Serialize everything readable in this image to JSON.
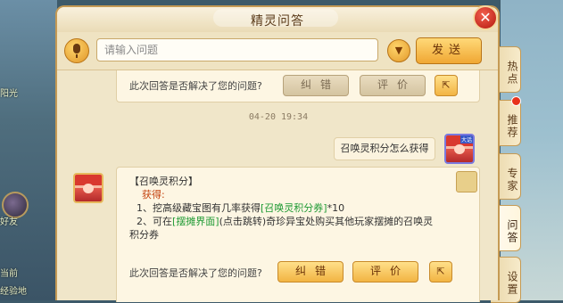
{
  "window": {
    "title": "精灵问答"
  },
  "input": {
    "placeholder": "请输入问题",
    "send_label": "发送"
  },
  "chat": {
    "prev_feedback": {
      "question": "此次回答是否解决了您的问题?",
      "correct_label": "纠错",
      "rate_label": "评价"
    },
    "timestamp": "04-20 19:34",
    "user_message": "召唤灵积分怎么获得",
    "user_avatar_badge": "大话",
    "answer": {
      "title": "【召唤灵积分】",
      "obtain_label": "获得:",
      "line1_prefix": "1、挖高级藏宝图有几率获得",
      "line1_item": "[召唤灵积分券]",
      "line1_suffix": "*10",
      "line2_prefix": "2、可在",
      "line2_link": "[摆摊界面]",
      "line2_suffix": "(点击跳转)奇珍异宝处购买其他玩家摆摊的召唤灵",
      "line3": "积分券"
    },
    "feedback": {
      "question": "此次回答是否解决了您的问题?",
      "correct_label": "纠错",
      "rate_label": "评价"
    }
  },
  "side_tabs": [
    {
      "label": "热点"
    },
    {
      "label": "推荐"
    },
    {
      "label": "专家"
    },
    {
      "label": "问答"
    },
    {
      "label": "设置"
    }
  ],
  "game_bg": {
    "left_texts": [
      "阳光",
      "好友",
      "当前",
      "经验地"
    ]
  },
  "icons": {
    "close": "close-icon",
    "mic": "microphone-icon",
    "dropdown": "chevron-down-icon",
    "share": "share-icon"
  },
  "colors": {
    "accent_red": "#c4400c",
    "accent_green": "#1f9a34",
    "button_gold": "#f2b443"
  }
}
